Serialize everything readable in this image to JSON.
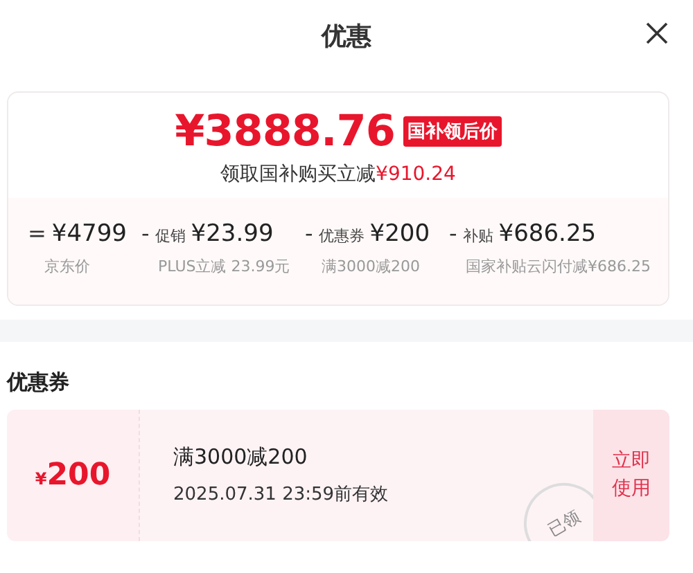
{
  "header": {
    "title": "优惠"
  },
  "summary": {
    "price_symbol": "¥",
    "price": "3888.76",
    "price_tag": "国补领后价",
    "subtitle": "领取国补购买立减",
    "subtitle_amount": "¥910.24",
    "breakdown": [
      {
        "operator": "=",
        "amount": "¥4799",
        "note": "京东价"
      },
      {
        "operator": "-",
        "label": "促销",
        "amount": "¥23.99",
        "note": "PLUS立减 23.99元"
      },
      {
        "operator": "-",
        "label": "优惠券",
        "amount": "¥200",
        "note": "满3000减200"
      },
      {
        "operator": "-",
        "label": "补贴",
        "amount": "¥686.25",
        "note": "国家补贴云闪付减¥686.25"
      }
    ]
  },
  "coupons_section": {
    "title": "优惠券",
    "coupons": [
      {
        "symbol": "¥",
        "value": "200",
        "condition": "满3000减200",
        "validity": "2025.07.31 23:59前有效",
        "stamp": "已领",
        "action": "立即使用"
      }
    ]
  }
}
